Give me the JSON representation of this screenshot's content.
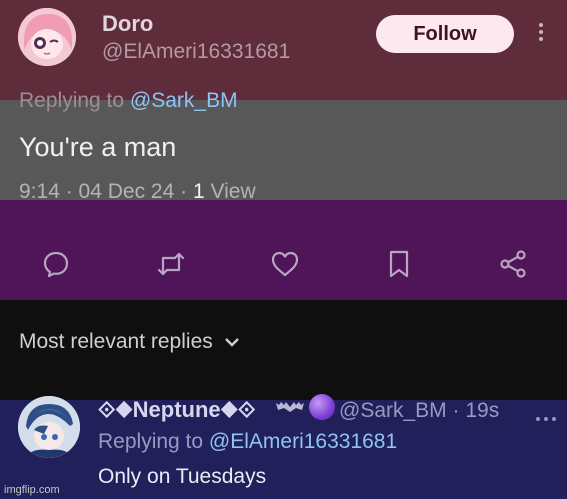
{
  "tweet": {
    "author_name": "Doro",
    "author_handle": "@ElAmeri16331681",
    "follow_label": "Follow",
    "replying_prefix": "Replying to",
    "replying_to": "@Sark_BM",
    "text": "You're a man",
    "time": "9:14",
    "date": "04 Dec 24",
    "views_count": "1",
    "views_label": "View"
  },
  "actions": [
    "reply-icon",
    "retweet-icon",
    "like-icon",
    "bookmark-icon",
    "share-icon"
  ],
  "sort": {
    "label": "Most relevant replies"
  },
  "reply": {
    "author_name": "⟐◆Neptune◆⟐",
    "author_handle": "@Sark_BM",
    "age": "19s",
    "replying_prefix": "Replying to",
    "replying_to": "@ElAmeri16331681",
    "text": "Only on Tuesdays"
  },
  "watermark": "imgflip.com",
  "colors": {
    "band1": "#5e2c3a",
    "band2": "#585858",
    "band3": "#4f1558",
    "band4": "#0f0f0f",
    "band5": "#22205a",
    "mention": "#8ec3f5",
    "follow_bg": "#fde8ef"
  }
}
